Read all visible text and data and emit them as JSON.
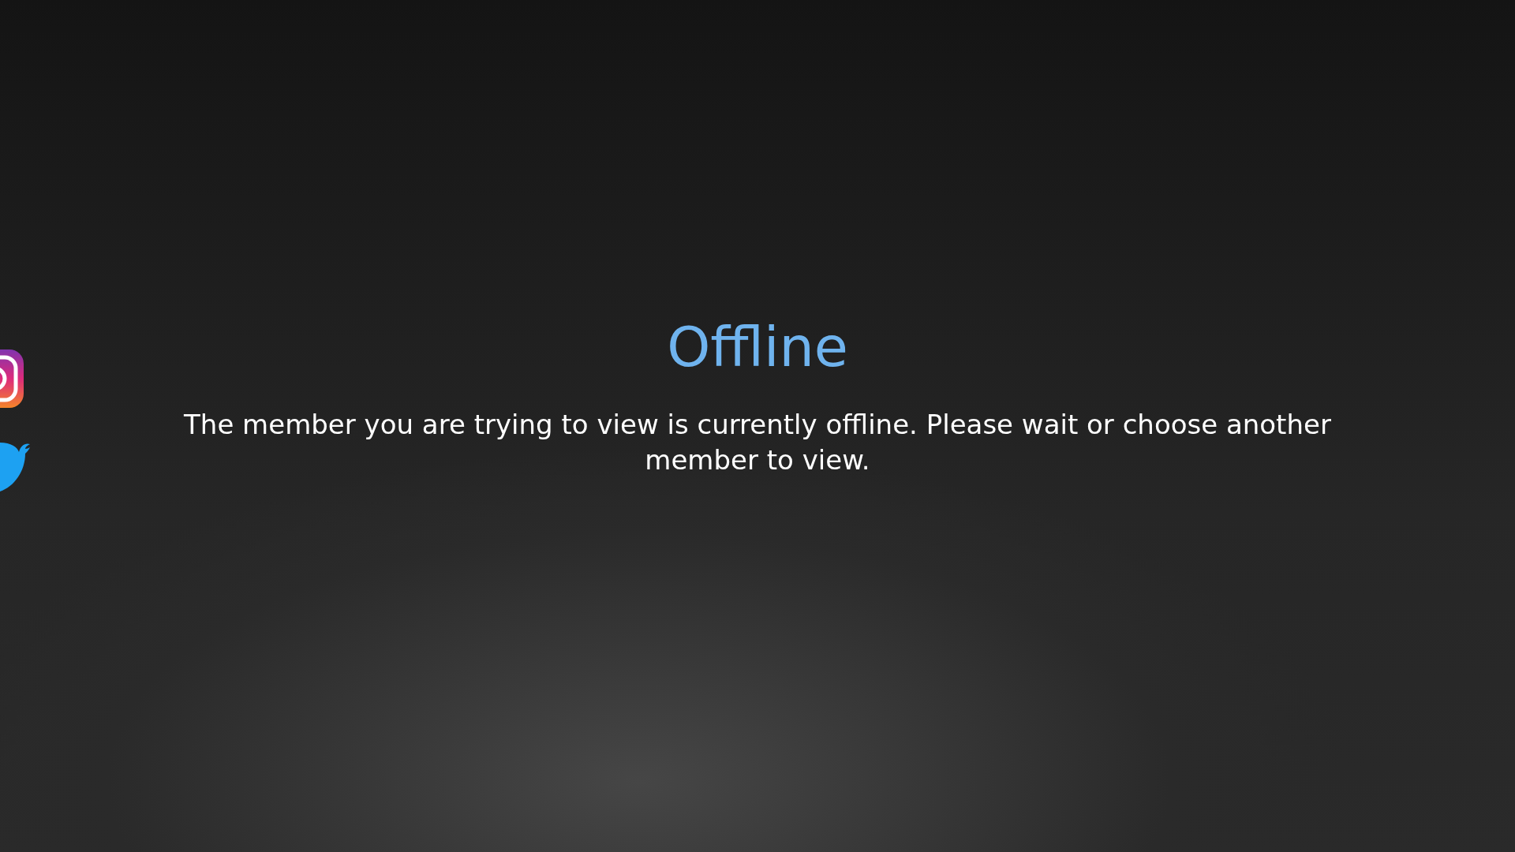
{
  "status": {
    "title": "Offline",
    "message": "The member you are trying to view is currently offline. Please wait or choose another member to view."
  },
  "social_links": [
    {
      "kind": "instagram"
    },
    {
      "kind": "bird"
    }
  ]
}
